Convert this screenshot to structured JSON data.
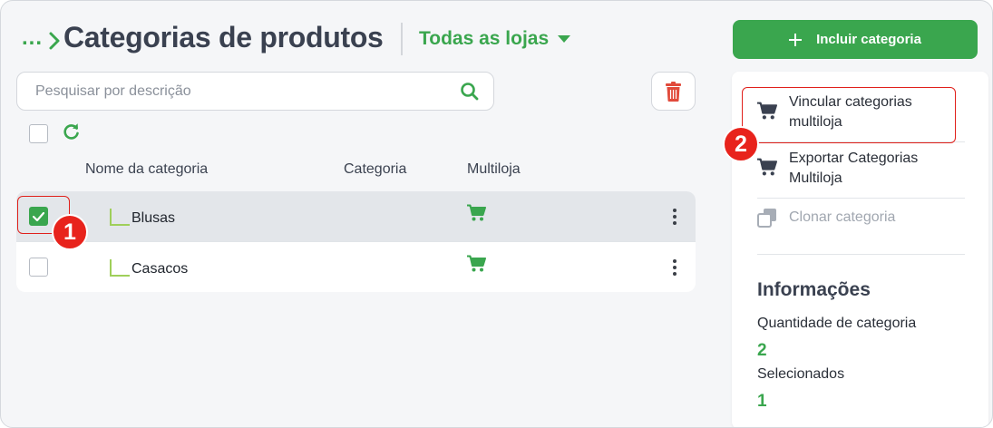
{
  "header": {
    "breadcrumb_dots": "...",
    "title": "Categorias de produtos",
    "store_filter": "Todas as lojas",
    "add_button": "Incluir categoria"
  },
  "search": {
    "placeholder": "Pesquisar por descrição",
    "value": ""
  },
  "table": {
    "columns": [
      "Nome da categoria",
      "Categoria",
      "Multiloja"
    ],
    "rows": [
      {
        "name": "Blusas",
        "selected": true,
        "multiloja_icon": "cart-icon"
      },
      {
        "name": "Casacos",
        "selected": false,
        "multiloja_icon": "cart-icon"
      }
    ]
  },
  "side_menu": {
    "items": [
      {
        "label": "Vincular categorias multiloja",
        "icon": "cart-icon",
        "enabled": true
      },
      {
        "label": "Exportar Categorias Multiloja",
        "icon": "cart-icon",
        "enabled": true
      },
      {
        "label": "Clonar categoria",
        "icon": "clone-icon",
        "enabled": false
      }
    ]
  },
  "info": {
    "title": "Informações",
    "quantity_label": "Quantidade de categoria",
    "quantity_value": "2",
    "selected_label": "Selecionados",
    "selected_value": "1"
  },
  "annotations": {
    "step1": "1",
    "step2": "2"
  },
  "colors": {
    "brand_green": "#3aa64e",
    "annotation_red": "#e8231c",
    "selected_row": "#e3e6ea"
  }
}
